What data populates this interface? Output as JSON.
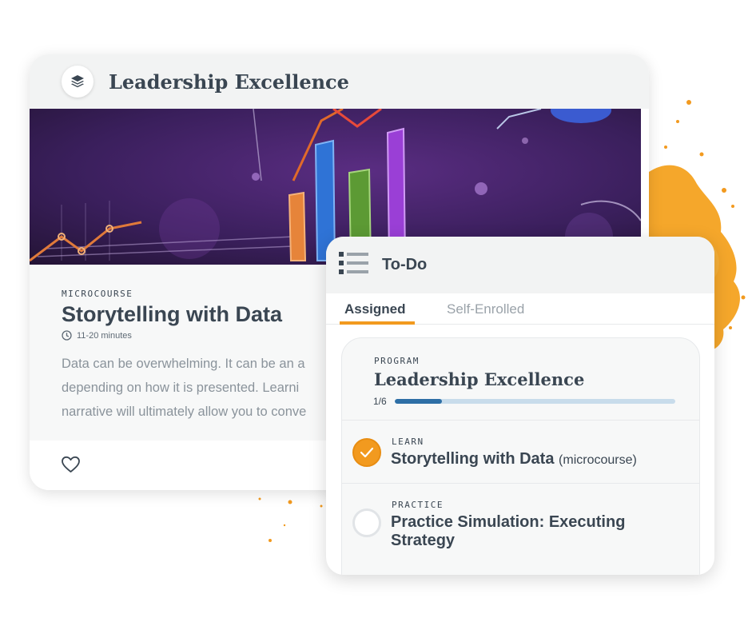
{
  "course_card": {
    "title": "Leadership Excellence",
    "icon": "layers-icon",
    "type_label": "MICROCOURSE",
    "name": "Storytelling with Data",
    "duration": "11-20 minutes",
    "description_lines": [
      "Data can be overwhelming. It can be an a",
      "depending on how it is presented. Learni",
      "narrative will ultimately allow you to conve"
    ],
    "favorite_icon": "heart-icon"
  },
  "todo": {
    "title": "To-Do",
    "icon": "list-icon",
    "tabs": [
      {
        "label": "Assigned",
        "active": true
      },
      {
        "label": "Self-Enrolled",
        "active": false
      }
    ],
    "program": {
      "type_label": "PROGRAM",
      "name": "Leadership Excellence",
      "progress_label": "1/6",
      "progress": 0.167
    },
    "steps": [
      {
        "type_label": "LEARN",
        "title": "Storytelling with Data",
        "suffix": "(microcourse)",
        "completed": true
      },
      {
        "type_label": "PRACTICE",
        "title_line1": "Practice Simulation: Executing",
        "title_line2": "Strategy",
        "completed": false
      }
    ]
  },
  "colors": {
    "accent_orange": "#f29a1f",
    "progress_blue": "#2e6fa6",
    "progress_track": "#c8dceb",
    "text_dark": "#3a4652",
    "text_muted": "#8a939b",
    "header_gray": "#f2f3f3"
  }
}
